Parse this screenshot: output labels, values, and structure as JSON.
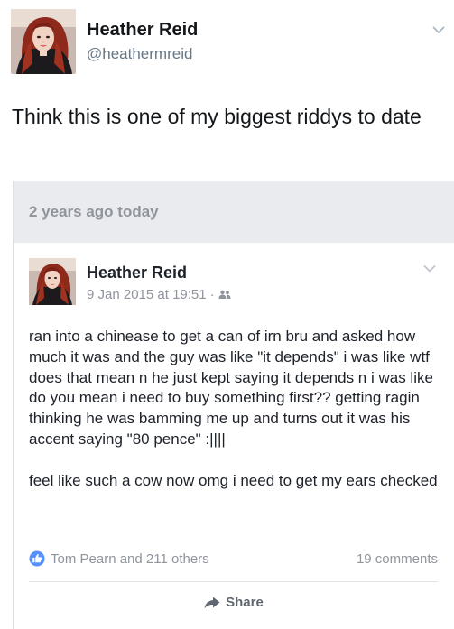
{
  "tweet": {
    "display_name": "Heather Reid",
    "handle": "@heathermreid",
    "text": "Think this is one of my biggest riddys to date"
  },
  "memory": {
    "label": "2 years ago today",
    "post": {
      "author": "Heather Reid",
      "timestamp": "9 Jan 2015 at 19:51",
      "separator": "·",
      "privacy_icon": "friends-icon",
      "paragraphs": [
        "ran into a chinease to get a can of irn bru and asked how much it was and the guy was like \"it depends\" i was like wtf does that mean n he just kept saying it depends n i was like do you mean i need to buy something first?? getting ragin thinking he was bamming me up and turns out it was his accent saying \"80 pence\" :||||",
        "feel like such a cow now omg i need to get my ears checked"
      ],
      "reactions": {
        "icon": "like-icon",
        "text": "Tom Pearn and 211 others"
      },
      "comments": "19 comments",
      "share_label": "Share"
    }
  },
  "colors": {
    "facebook_blue": "#4267b2",
    "muted_text": "#90949c",
    "banner_bg": "#e9ebee",
    "twitter_handle": "#657786"
  }
}
